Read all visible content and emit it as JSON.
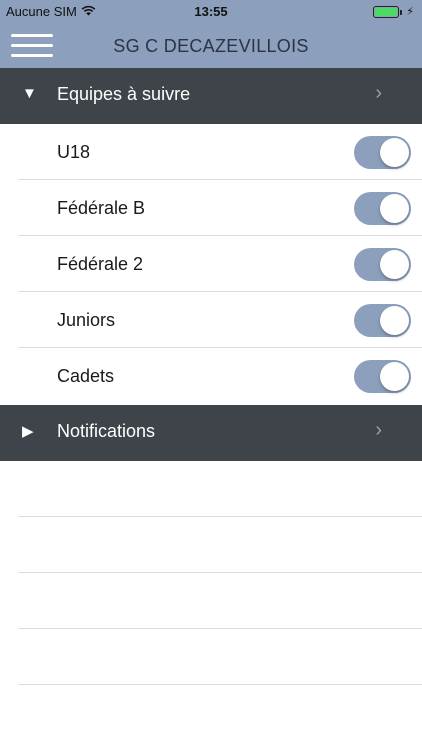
{
  "status_bar": {
    "carrier": "Aucune SIM",
    "time": "13:55",
    "wifi_icon": "wifi-icon",
    "battery_icon": "battery-icon"
  },
  "nav": {
    "title": "SG C DECAZEVILLOIS",
    "menu_icon": "hamburger-menu-icon"
  },
  "sections": [
    {
      "label": "Equipes à suivre",
      "expanded": true,
      "items": [
        {
          "label": "U18",
          "on": true
        },
        {
          "label": "Fédérale B",
          "on": true
        },
        {
          "label": "Fédérale 2",
          "on": true
        },
        {
          "label": "Juniors",
          "on": true
        },
        {
          "label": "Cadets",
          "on": true
        }
      ]
    },
    {
      "label": "Notifications",
      "expanded": false
    }
  ],
  "colors": {
    "bar": "#8c9fbc",
    "section_header": "#3e4449",
    "toggle_on": "#8c9fbc"
  }
}
